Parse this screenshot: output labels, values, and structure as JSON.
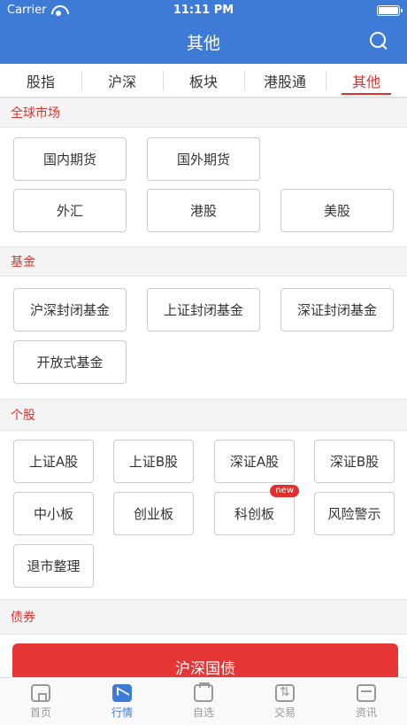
{
  "status_bar": {
    "carrier": "Carrier",
    "time": "11:11 PM"
  },
  "header": {
    "title": "其他"
  },
  "tabs": [
    {
      "label": "股指"
    },
    {
      "label": "沪深"
    },
    {
      "label": "板块"
    },
    {
      "label": "港股通"
    },
    {
      "label": "其他"
    }
  ],
  "sections": {
    "global": {
      "title": "全球市场",
      "items": [
        {
          "label": "国内期货"
        },
        {
          "label": "国外期货"
        },
        {
          "label": "外汇"
        },
        {
          "label": "港股"
        },
        {
          "label": "美股"
        }
      ]
    },
    "fund": {
      "title": "基金",
      "items": [
        {
          "label": "沪深封闭基金"
        },
        {
          "label": "上证封闭基金"
        },
        {
          "label": "深证封闭基金"
        },
        {
          "label": "开放式基金"
        }
      ]
    },
    "stock": {
      "title": "个股",
      "items": [
        {
          "label": "上证A股"
        },
        {
          "label": "上证B股"
        },
        {
          "label": "深证A股"
        },
        {
          "label": "深证B股"
        },
        {
          "label": "中小板"
        },
        {
          "label": "创业板"
        },
        {
          "label": "科创板",
          "badge": "new"
        },
        {
          "label": "风险警示"
        },
        {
          "label": "退市整理"
        }
      ]
    },
    "bond": {
      "title": "债券",
      "button": "沪深国债"
    }
  },
  "tabbar": [
    {
      "label": "首页",
      "icon": "home-icon"
    },
    {
      "label": "行情",
      "icon": "chart-icon"
    },
    {
      "label": "自选",
      "icon": "folder-icon"
    },
    {
      "label": "交易",
      "icon": "trade-icon"
    },
    {
      "label": "资讯",
      "icon": "news-icon"
    }
  ]
}
